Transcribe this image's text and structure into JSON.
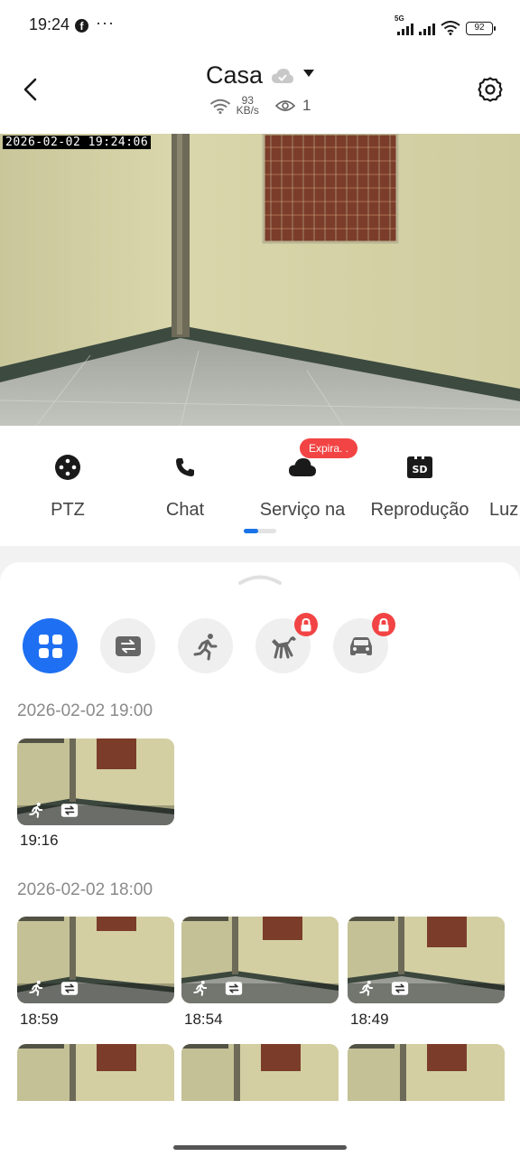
{
  "status_bar": {
    "time": "19:24",
    "fb_icon": "facebook-icon",
    "dots": "···",
    "network_tag": "5G",
    "battery": "92"
  },
  "header": {
    "title": "Casa",
    "speed_value": "93",
    "speed_unit": "KB/s",
    "viewers": "1",
    "icons": [
      "back-icon",
      "cloud-icon",
      "wifi-icon",
      "eye-icon",
      "settings-icon"
    ]
  },
  "camera": {
    "timestamp": "2026-02-02 19:24:06"
  },
  "tools": {
    "items": [
      {
        "label": "PTZ",
        "icon": "joystick-icon"
      },
      {
        "label": "Chat",
        "icon": "phone-icon"
      },
      {
        "label": "Serviço na",
        "icon": "cloud-icon"
      },
      {
        "label": "Reprodução",
        "icon": "sd-card-icon"
      },
      {
        "label": "Luz",
        "icon": "light-icon"
      }
    ],
    "badge": "Expira. .",
    "accent": "#1a73e8",
    "badge_color": "#f24444"
  },
  "filters": {
    "items": [
      "all-grid-icon",
      "camera-switch-icon",
      "motion-person-icon",
      "pet-icon",
      "car-icon"
    ],
    "locked": [
      "pet-icon",
      "car-icon"
    ],
    "active_color": "#1e6ff2"
  },
  "events": {
    "groups": [
      {
        "date": "2026-02-02 19:00",
        "clips": [
          {
            "time": "19:16"
          }
        ]
      },
      {
        "date": "2026-02-02 18:00",
        "clips": [
          {
            "time": "18:59"
          },
          {
            "time": "18:54"
          },
          {
            "time": "18:49"
          }
        ]
      }
    ]
  }
}
